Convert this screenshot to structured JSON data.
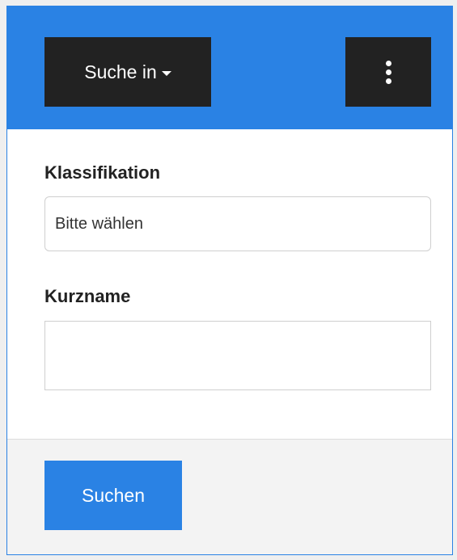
{
  "header": {
    "search_in_label": "Suche in",
    "more_icon": "kebab-vertical-icon",
    "caret_icon": "caret-down-icon"
  },
  "form": {
    "classification": {
      "label": "Klassifikation",
      "value": "Bitte wählen"
    },
    "short_name": {
      "label": "Kurzname",
      "value": "",
      "placeholder": ""
    }
  },
  "footer": {
    "submit_label": "Suchen"
  },
  "colors": {
    "accent": "#2a82e4",
    "dark_button": "#222222",
    "footer_bg": "#f3f3f3"
  }
}
